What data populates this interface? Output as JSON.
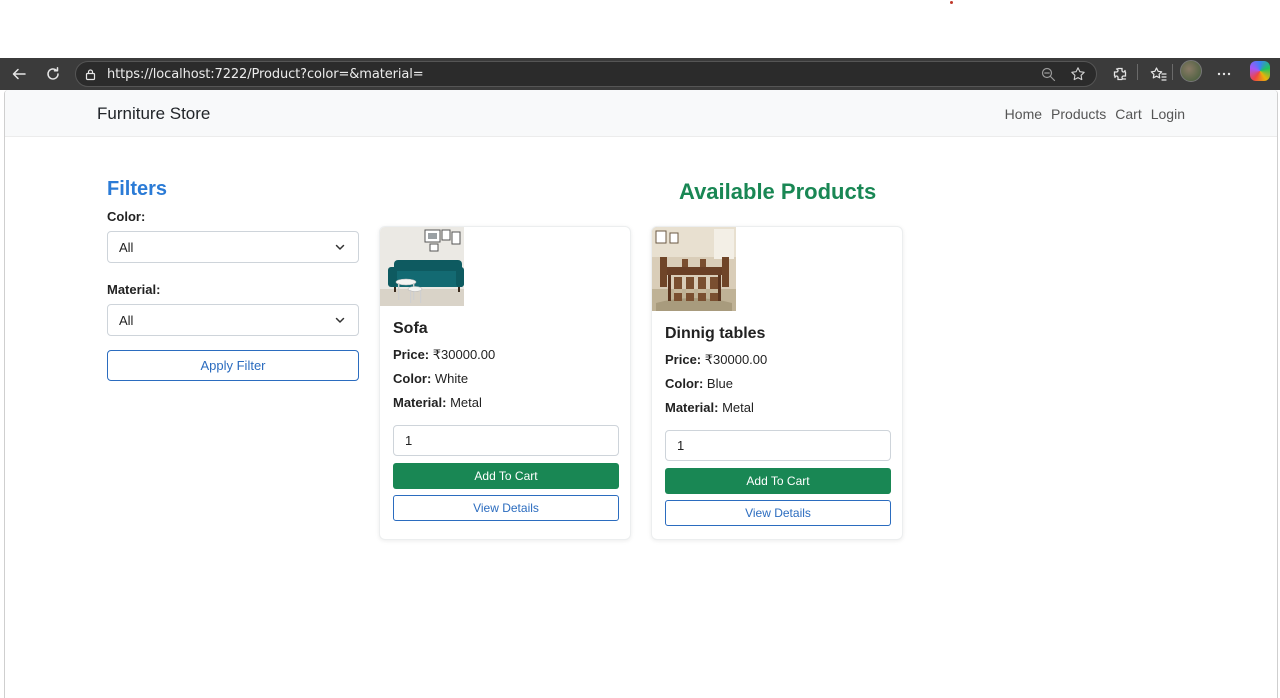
{
  "browser": {
    "url": "https://localhost:7222/Product?color=&material="
  },
  "navbar": {
    "brand": "Furniture Store",
    "links": [
      "Home",
      "Products",
      "Cart",
      "Login"
    ]
  },
  "filters": {
    "title": "Filters",
    "color_label": "Color:",
    "color_value": "All",
    "material_label": "Material:",
    "material_value": "All",
    "apply_label": "Apply Filter"
  },
  "main": {
    "title": "Available Products",
    "products": [
      {
        "name": "Sofa",
        "price_label": "Price:",
        "price": "₹30000.00",
        "color_label": "Color:",
        "color": "White",
        "material_label": "Material:",
        "material": "Metal",
        "quantity": "1",
        "add_label": "Add To Cart",
        "details_label": "View Details"
      },
      {
        "name": "Dinnig tables",
        "price_label": "Price:",
        "price": "₹30000.00",
        "color_label": "Color:",
        "color": "Blue",
        "material_label": "Material:",
        "material": "Metal",
        "quantity": "1",
        "add_label": "Add To Cart",
        "details_label": "View Details"
      }
    ]
  },
  "colors": {
    "accent_blue": "#2b6cbf",
    "accent_green": "#198754",
    "filters_title": "#2b7bd6"
  }
}
